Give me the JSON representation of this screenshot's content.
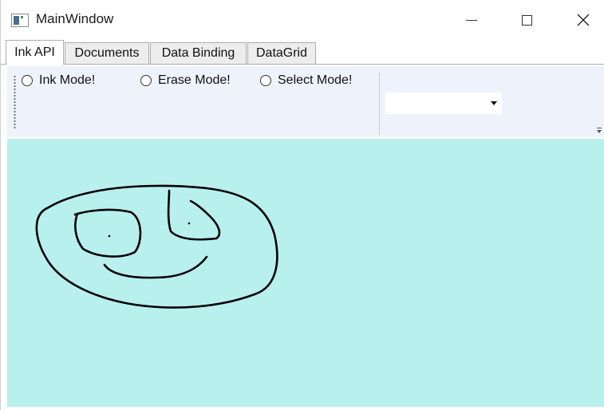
{
  "window": {
    "title": "MainWindow",
    "controls": {
      "minimize": "—",
      "maximize": "☐",
      "close": "✕"
    }
  },
  "tabs": [
    {
      "label": "Ink API",
      "active": true
    },
    {
      "label": "Documents",
      "active": false
    },
    {
      "label": "Data Binding",
      "active": false
    },
    {
      "label": "DataGrid",
      "active": false
    }
  ],
  "toolbar": {
    "modes": [
      {
        "label": "Ink Mode!",
        "checked": false
      },
      {
        "label": "Erase Mode!",
        "checked": false
      },
      {
        "label": "Select Mode!",
        "checked": false
      }
    ],
    "combo_value": ""
  },
  "canvas": {
    "background": "#b8f0ee",
    "stroke_color": "#000000",
    "drawing": "smiley face ink strokes"
  }
}
